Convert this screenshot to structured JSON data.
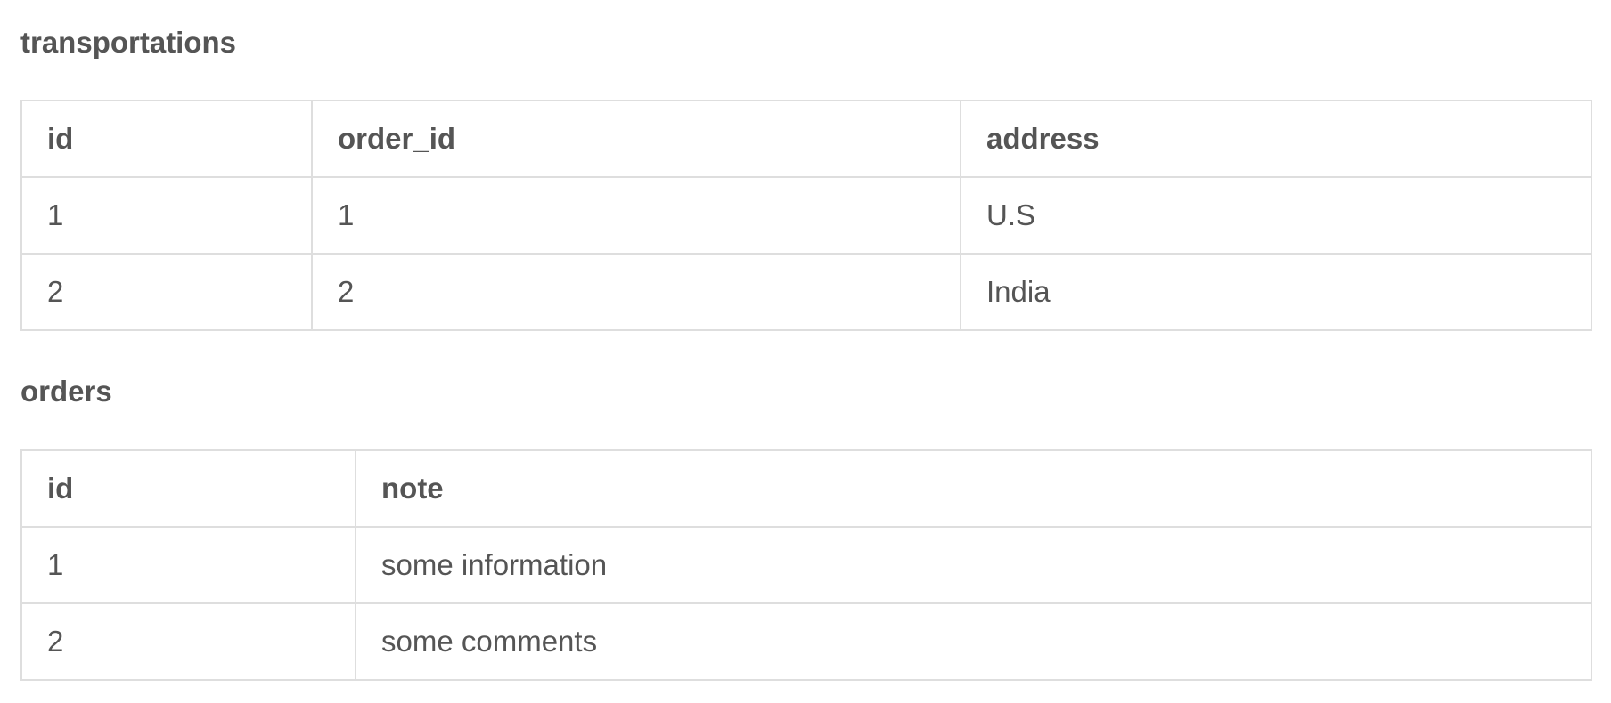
{
  "transportations": {
    "title": "transportations",
    "columns": [
      "id",
      "order_id",
      "address"
    ],
    "rows": [
      [
        "1",
        "1",
        "U.S"
      ],
      [
        "2",
        "2",
        "India"
      ]
    ]
  },
  "orders": {
    "title": "orders",
    "columns": [
      "id",
      "note"
    ],
    "rows": [
      [
        "1",
        "some information"
      ],
      [
        "2",
        "some comments"
      ]
    ]
  },
  "colors": {
    "text": "#555555",
    "border": "#dedede",
    "background": "#ffffff"
  }
}
